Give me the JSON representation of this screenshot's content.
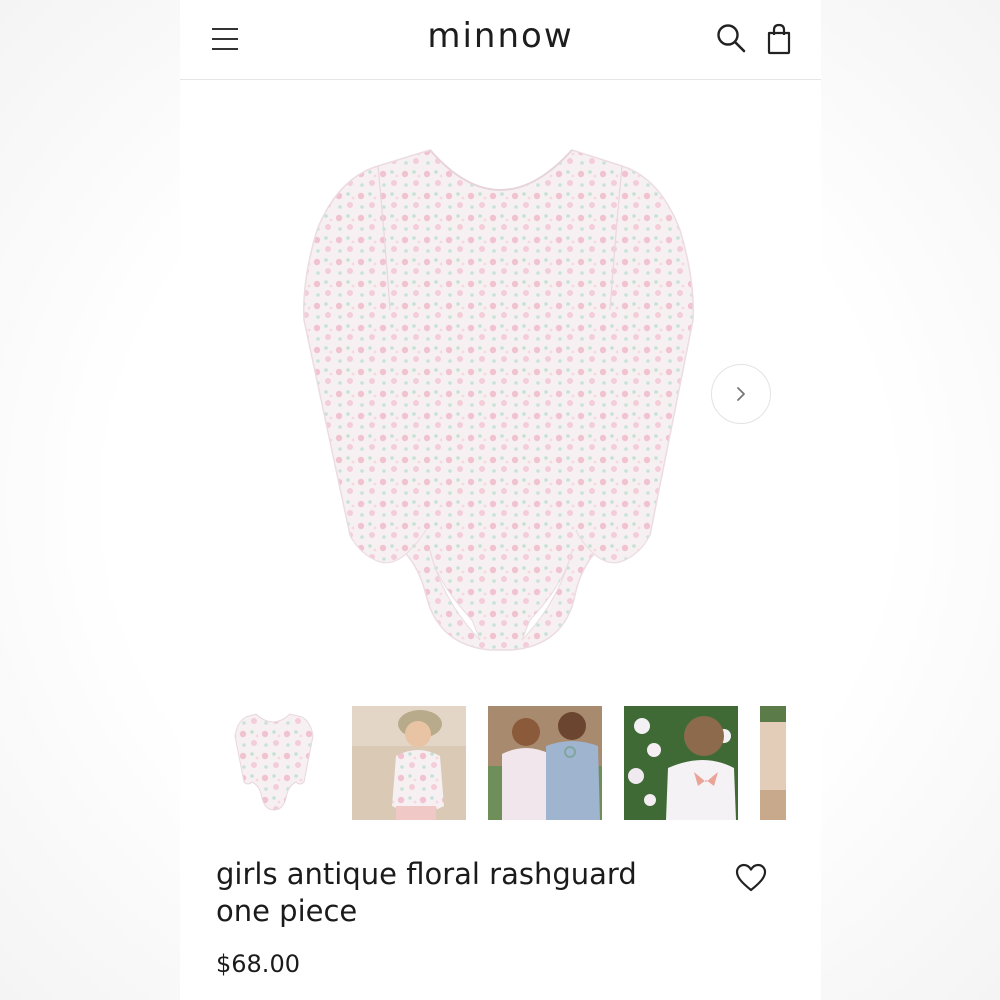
{
  "header": {
    "brand": "minnow",
    "menu_icon": "hamburger-menu-icon",
    "search_icon": "search-icon",
    "cart_icon": "shopping-bag-icon"
  },
  "gallery": {
    "next_icon": "chevron-right-icon",
    "thumbnail_count_visible": 5
  },
  "product": {
    "title": "girls antique floral rashguard one piece",
    "price": "$68.00",
    "wishlist_icon": "heart-icon"
  },
  "colors": {
    "text": "#1b1b1b",
    "swimsuit_base": "#f6eff1",
    "floral_pink": "#f2c6d3",
    "floral_green": "#bfe0d2",
    "divider": "#e6e6e6"
  }
}
